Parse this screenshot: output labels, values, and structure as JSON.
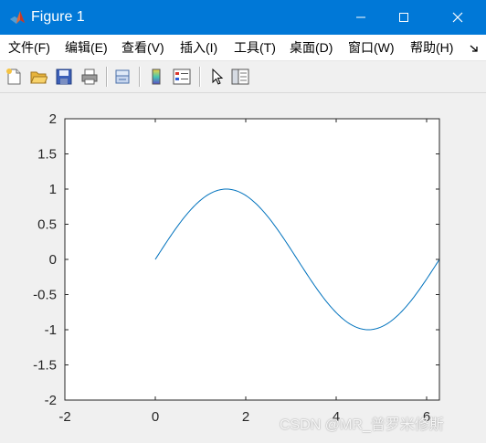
{
  "window": {
    "title": "Figure 1",
    "accent_color": "#0078d7",
    "icons": [
      "matlab-logo-icon",
      "minimize-icon",
      "maximize-icon",
      "close-icon"
    ]
  },
  "menu": {
    "items": [
      {
        "label": "文件(F)"
      },
      {
        "label": "编辑(E)"
      },
      {
        "label": "查看(V)"
      },
      {
        "label": "插入(I)"
      },
      {
        "label": "工具(T)"
      },
      {
        "label": "桌面(D)"
      },
      {
        "label": "窗口(W)"
      },
      {
        "label": "帮助(H)"
      }
    ],
    "overflow_icon": "menu-overflow-arrow-icon"
  },
  "toolbar": {
    "icons": [
      "new-figure-icon",
      "open-file-icon",
      "save-icon",
      "print-icon",
      "link-plot-icon",
      "insert-colorbar-icon",
      "insert-legend-icon",
      "edit-plot-arrow-icon",
      "property-inspector-icon"
    ]
  },
  "chart_data": {
    "type": "line",
    "title": "",
    "xlabel": "",
    "ylabel": "",
    "xlim": [
      -2,
      6.283
    ],
    "ylim": [
      -2,
      2
    ],
    "xticks": [
      "-2",
      "0",
      "2",
      "4",
      "6"
    ],
    "yticks": [
      "2",
      "1.5",
      "1",
      "0.5",
      "0",
      "-0.5",
      "-1",
      "-1.5",
      "-2"
    ],
    "grid": false,
    "series": [
      {
        "color": "#0072bd",
        "function": "sin(x)",
        "x_range": [
          0,
          6.2832
        ]
      }
    ]
  },
  "watermark": "CSDN @MR_普罗米修斯"
}
